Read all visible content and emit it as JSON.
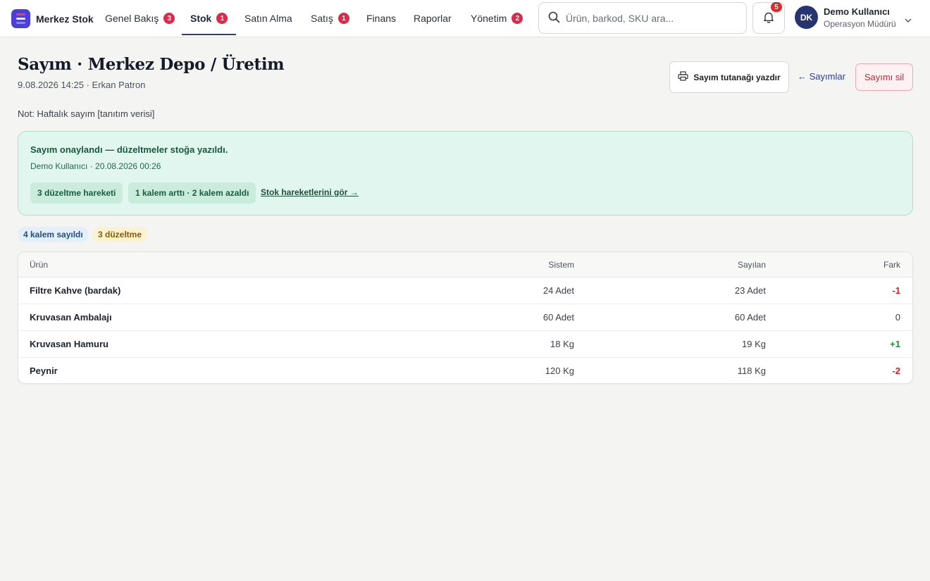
{
  "app": {
    "name": "Merkez Stok",
    "brand_colors": [
      "#e9445e",
      "#f0f0f8",
      "#8e84f5"
    ]
  },
  "nav": {
    "items": [
      {
        "label": "Genel Bakış",
        "badge": "3"
      },
      {
        "label": "Stok",
        "badge": "1",
        "active": true
      },
      {
        "label": "Satın Alma"
      },
      {
        "label": "Satış",
        "badge": "1"
      },
      {
        "label": "Finans"
      },
      {
        "label": "Raporlar"
      },
      {
        "label": "Yönetim",
        "badge": "2"
      }
    ]
  },
  "search": {
    "placeholder": "Ürün, barkod, SKU ara...",
    "icon": "search-icon"
  },
  "notifications": {
    "count": "5",
    "icon": "bell-icon"
  },
  "user": {
    "initials": "DK",
    "name": "Demo Kullanıcı",
    "role": "Operasyon Müdürü"
  },
  "page": {
    "title": "Sayım · Merkez Depo / Üretim",
    "subtitle": "9.08.2026 14:25 · Erkan Patron",
    "note": "Not: Haftalık sayım [tanıtım verisi]",
    "print_label": "Sayım tutanağı yazdır",
    "back_label": "← Sayımlar",
    "delete_label": "Sayımı sil"
  },
  "approval": {
    "title": "Sayım onaylandı — düzeltmeler stoğa yazıldı.",
    "meta": "Demo Kullanıcı · 20.08.2026 00:26",
    "chip_moves": "3 düzeltme hareketi",
    "chip_changes": "1 kalem arttı · 2 kalem azaldı",
    "link": "Stok hareketlerini gör →"
  },
  "summary": {
    "counted": "4 kalem sayıldı",
    "adjustments": "3 düzeltme"
  },
  "table": {
    "headers": {
      "product": "Ürün",
      "system": "Sistem",
      "counted": "Sayılan",
      "diff": "Fark"
    },
    "rows": [
      {
        "product": "Filtre Kahve (bardak)",
        "system": "24 Adet",
        "counted": "23 Adet",
        "diff": "-1"
      },
      {
        "product": "Kruvasan Ambalajı",
        "system": "60 Adet",
        "counted": "60 Adet",
        "diff": "0"
      },
      {
        "product": "Kruvasan Hamuru",
        "system": "18 Kg",
        "counted": "19 Kg",
        "diff": "+1"
      },
      {
        "product": "Peynir",
        "system": "120 Kg",
        "counted": "118 Kg",
        "diff": "-2"
      }
    ]
  },
  "colors": {
    "accent": "#2f3a7a",
    "badge": "#dd2a4a",
    "success_bg": "#e1f6ee",
    "negative": "#c4202f",
    "positive": "#1e8a3c"
  }
}
